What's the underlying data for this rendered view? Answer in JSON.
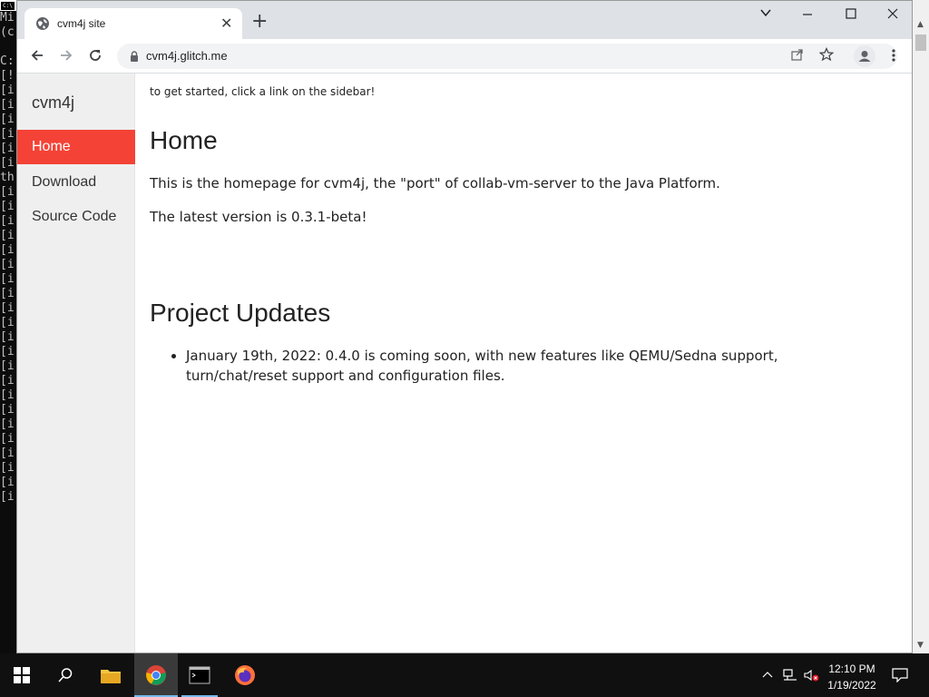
{
  "console": {
    "lines": [
      "Mi",
      "(c",
      "",
      "C:",
      "[!",
      "[i",
      "[i",
      "[i",
      "[i",
      "[i",
      "[i",
      "th",
      "[i",
      "[i",
      "[i",
      "[i",
      "[i",
      "[i",
      "[i",
      "[i",
      "[i",
      "[i",
      "[i",
      "[i",
      "[i",
      "[i",
      "[i",
      "[i",
      "[i",
      "[i",
      "[i",
      "[i",
      "[i",
      "[i"
    ]
  },
  "browser": {
    "tab": {
      "title": "cvm4j site"
    },
    "url": "cvm4j.glitch.me"
  },
  "sidebar": {
    "brand": "cvm4j",
    "items": [
      {
        "label": "Home",
        "active": true
      },
      {
        "label": "Download",
        "active": false
      },
      {
        "label": "Source Code",
        "active": false
      }
    ]
  },
  "content": {
    "intro": "to get started, click a link on the sidebar!",
    "home_heading": "Home",
    "home_p1": "This is the homepage for cvm4j, the \"port\" of collab-vm-server to the Java Platform.",
    "home_p2": "The latest version is 0.3.1-beta!",
    "updates_heading": "Project Updates",
    "updates": [
      "January 19th, 2022: 0.4.0 is coming soon, with new features like QEMU/Sedna support, turn/chat/reset support and configuration files."
    ]
  },
  "taskbar": {
    "time": "12:10 PM",
    "date": "1/19/2022"
  },
  "colors": {
    "accent": "#f44336",
    "sidebar_bg": "#efefef",
    "tabstrip_bg": "#dee1e6"
  }
}
